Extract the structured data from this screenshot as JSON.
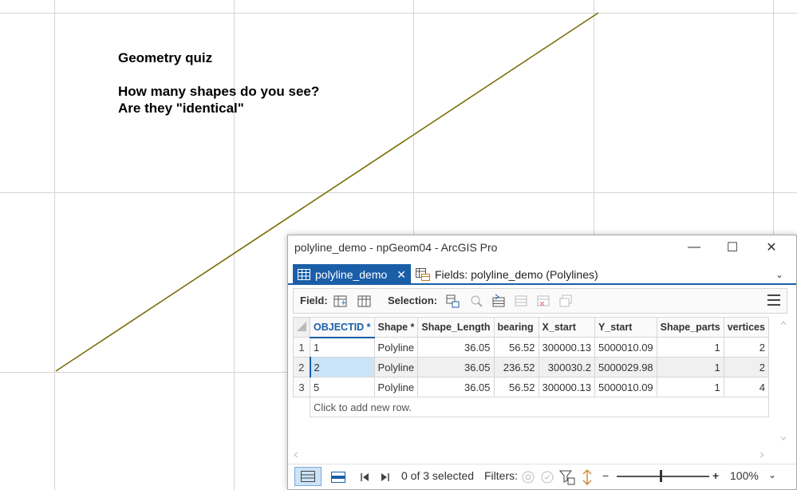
{
  "quiz": {
    "line1": "Geometry quiz",
    "line2": "How many shapes do you see?",
    "line3": "Are they \"identical\""
  },
  "window": {
    "title": "polyline_demo - npGeom04 - ArcGIS Pro",
    "controls": {
      "minimize": "—",
      "maximize": "☐",
      "close": "✕"
    }
  },
  "tabs": {
    "active_label": "polyline_demo",
    "close_glyph": "✕",
    "fields_label": "Fields: polyline_demo (Polylines)",
    "menu_glyph": "⌄"
  },
  "toolbar": {
    "field_label": "Field:",
    "selection_label": "Selection:"
  },
  "table": {
    "columns": [
      "OBJECTID *",
      "Shape *",
      "Shape_Length",
      "bearing",
      "X_start",
      "Y_start",
      "Shape_parts",
      "vertices"
    ],
    "rows": [
      {
        "rownum": "1",
        "cells": [
          "1",
          "Polyline",
          "36.05",
          "56.52",
          "300000.13",
          "5000010.09",
          "1",
          "2"
        ]
      },
      {
        "rownum": "2",
        "cells": [
          "2",
          "Polyline",
          "36.05",
          "236.52",
          "300030.2",
          "5000029.98",
          "1",
          "2"
        ]
      },
      {
        "rownum": "3",
        "cells": [
          "5",
          "Polyline",
          "36.05",
          "56.52",
          "300000.13",
          "5000010.09",
          "1",
          "4"
        ]
      }
    ],
    "add_row": "Click to add new row."
  },
  "status": {
    "selected_text": "0 of 3 selected",
    "filters_label": "Filters:",
    "zoom_minus": "−",
    "zoom_plus": "+",
    "zoom_value": "100%",
    "zoom_dropdown": "⌄"
  },
  "colors": {
    "line": "#7a6f0a",
    "accent": "#1a5ea8",
    "grid": "#d4d4d4"
  }
}
